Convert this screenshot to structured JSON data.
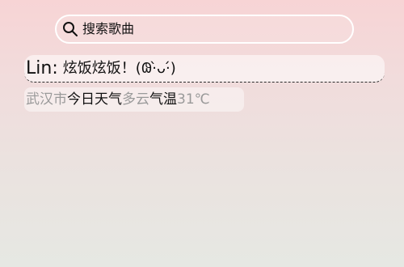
{
  "search": {
    "label": "搜索歌曲",
    "icon": "search-icon"
  },
  "chat": {
    "user": "Lin",
    "colon": ":",
    "message": "炫饭炫饭！(𐐘·̀ᴗ·́)"
  },
  "weather": {
    "city": "武汉市",
    "today_label": "今日天气",
    "condition": "多云",
    "temp_label": "气温",
    "temperature": "31℃"
  },
  "colors": {
    "background_top": "#f7d4d5",
    "background_bottom": "#e6e8e3",
    "text_primary": "#111111",
    "text_muted": "#9a9a9a"
  }
}
